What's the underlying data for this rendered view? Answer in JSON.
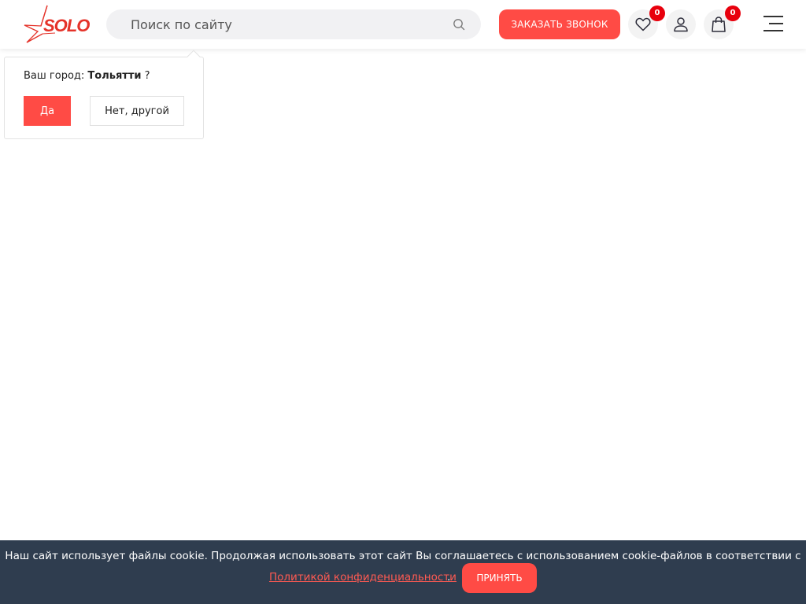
{
  "brand": {
    "logo_text": "SOLO",
    "accent_color": "#ff4b45",
    "logo_color": "#e5332a"
  },
  "header": {
    "search": {
      "placeholder": "Поиск по сайту",
      "value": ""
    },
    "call_button_label": "ЗАКАЗАТЬ ЗВОНОК",
    "favorites": {
      "icon": "heart-icon",
      "count": "0"
    },
    "profile": {
      "icon": "user-icon"
    },
    "cart": {
      "icon": "bag-icon",
      "count": "0"
    },
    "menu": {
      "icon": "burger-menu-icon"
    }
  },
  "city_popup": {
    "question_prefix": "Ваш город:",
    "city": "Тольятти",
    "question_suffix": "?",
    "yes_label": "Да",
    "no_label": "Нет, другой"
  },
  "cookie_bar": {
    "text": "Наш сайт использует файлы cookie. Продолжая использовать этот сайт Вы соглашаетесь с использованием cookie-файлов в соответствии с",
    "link_text": "Политикой конфиденциальности",
    "link_suffix": ".",
    "accept_label": "ПРИНЯТЬ",
    "background_color": "#2f3d4f"
  }
}
